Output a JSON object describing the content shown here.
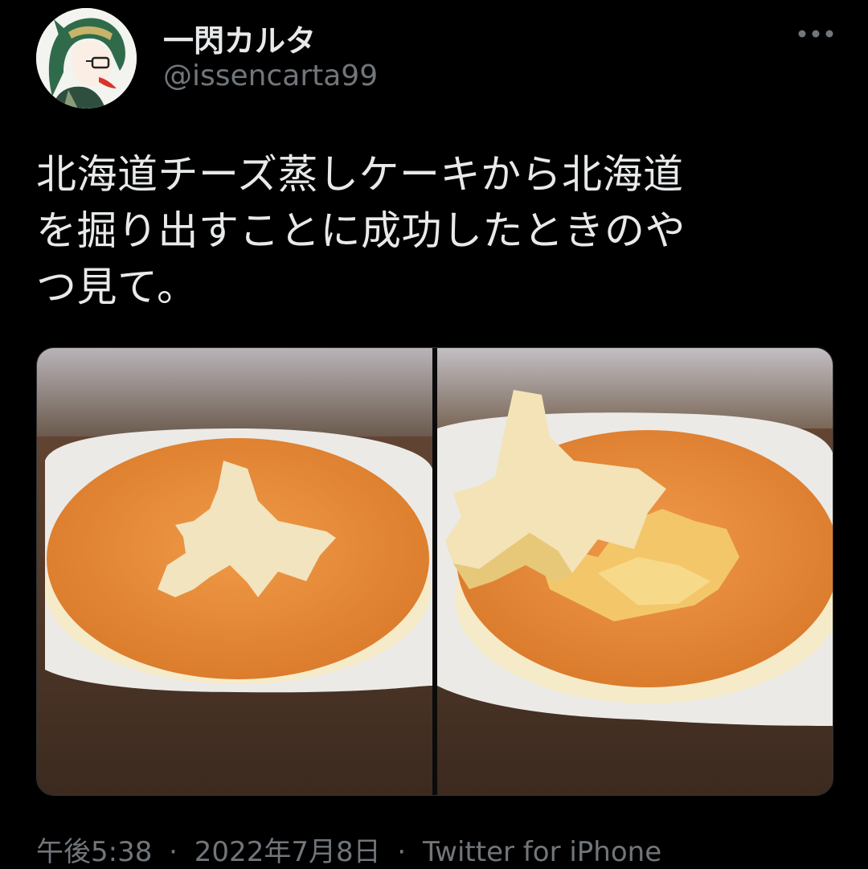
{
  "user": {
    "display_name": "一閃カルタ",
    "handle": "@issencarta99"
  },
  "tweet": {
    "lines": [
      "北海道チーズ蒸しケーキから北海道",
      "を掘り出すことに成功したときのや",
      "つ見て。"
    ],
    "time": "午後5:38",
    "date": "2022年7月8日",
    "separator": "·",
    "source": "Twitter for iPhone"
  },
  "icons": {
    "more": "more-horizontal-icon",
    "avatar": "user-avatar-illustration"
  },
  "colors": {
    "background": "#000000",
    "text_primary": "#e7e9ea",
    "text_secondary": "#71767b",
    "cake_top": "#e8893a",
    "cake_body": "#f5e6b8"
  }
}
